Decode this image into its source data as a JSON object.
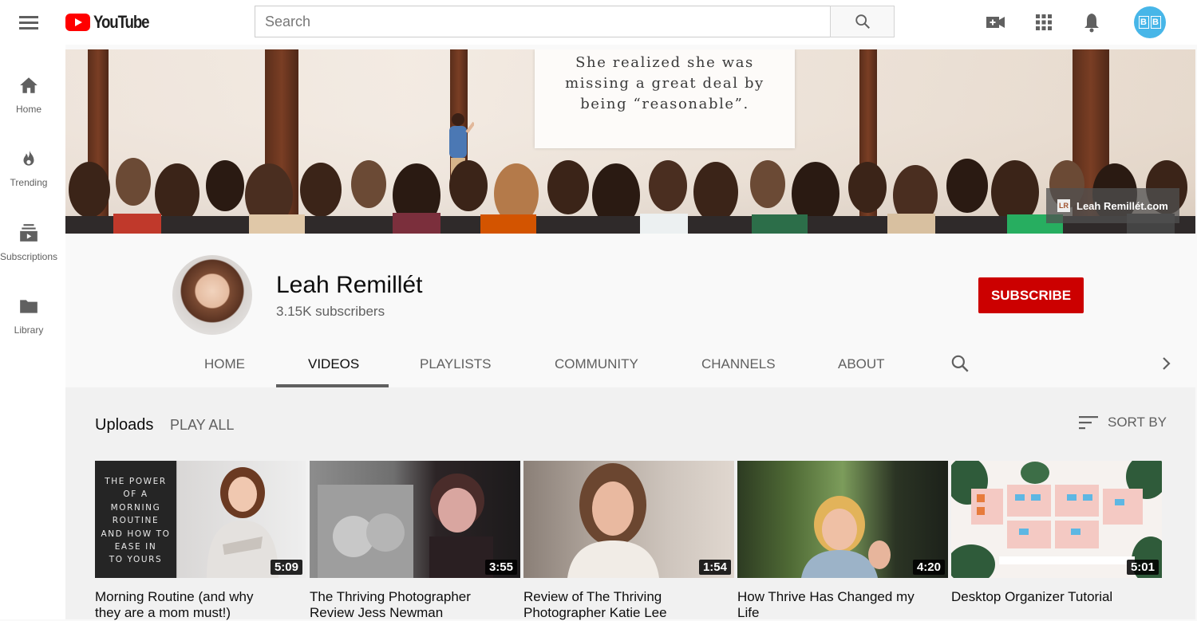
{
  "header": {
    "logo_text": "YouTube",
    "search_placeholder": "Search",
    "avatar_initials": [
      "B",
      "B"
    ]
  },
  "sidebar": {
    "items": [
      {
        "label": "Home",
        "icon": "home-icon"
      },
      {
        "label": "Trending",
        "icon": "flame-icon"
      },
      {
        "label": "Subscriptions",
        "icon": "subscriptions-icon"
      },
      {
        "label": "Library",
        "icon": "folder-icon"
      }
    ]
  },
  "banner": {
    "quote_lines": [
      "She realized she was",
      "missing a great deal by",
      "being “reasonable”."
    ],
    "watermark_logo": "LR",
    "watermark_text": "Leah Remillét.com"
  },
  "channel": {
    "name": "Leah Remillét",
    "subscribers": "3.15K subscribers",
    "subscribe_label": "SUBSCRIBE",
    "tabs": [
      "HOME",
      "VIDEOS",
      "PLAYLISTS",
      "COMMUNITY",
      "CHANNELS",
      "ABOUT"
    ],
    "active_tab": "VIDEOS"
  },
  "uploads": {
    "heading": "Uploads",
    "play_all": "PLAY ALL",
    "sort_by": "SORT BY",
    "videos": [
      {
        "title_line1": "Morning Routine (and why",
        "title_line2": "they are a mom must!)",
        "duration": "5:09",
        "thumb_text": [
          "THE POWER",
          "OF A",
          "MORNING",
          "ROUTINE",
          "AND HOW TO",
          "EASE IN",
          "TO YOURS"
        ]
      },
      {
        "title_line1": "The Thriving Photographer",
        "title_line2": "Review Jess Newman",
        "duration": "3:55"
      },
      {
        "title_line1": "Review of The Thriving",
        "title_line2": "Photographer Katie Lee",
        "duration": "1:54"
      },
      {
        "title_line1": "How Thrive Has Changed my",
        "title_line2": "Life",
        "duration": "4:20"
      },
      {
        "title_line1": "Desktop Organizer Tutorial",
        "title_line2": "",
        "duration": "5:01"
      }
    ]
  },
  "colors": {
    "brand_red": "#ff0000",
    "subscribe_red": "#cc0000",
    "avatar_blue": "#47b6e8"
  }
}
